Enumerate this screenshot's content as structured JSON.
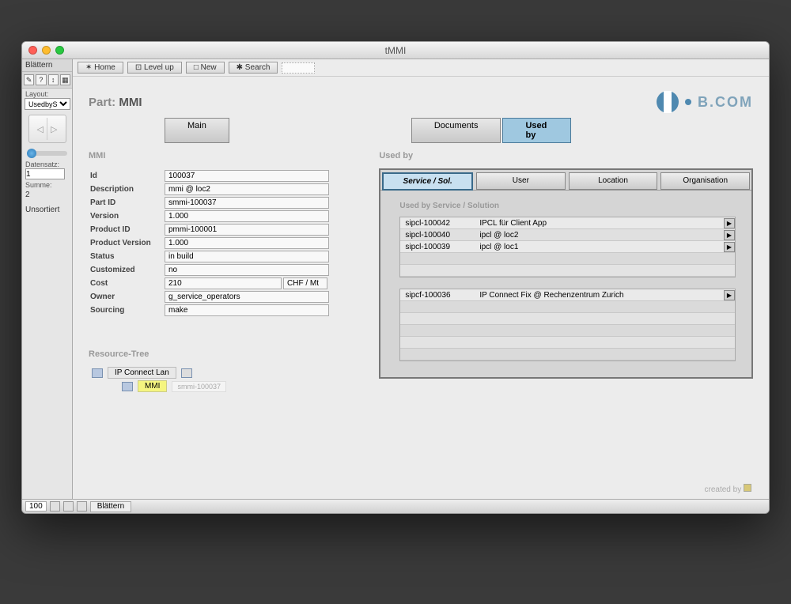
{
  "window": {
    "title": "tMMI"
  },
  "leftpane": {
    "blattern": "Blättern",
    "layout_lbl": "Layout:",
    "layout_val": "UsedbySe",
    "datensatz_lbl": "Datensatz:",
    "datensatz_val": "1",
    "summe_lbl": "Summe:",
    "summe_val": "2",
    "unsortiert": "Unsortiert"
  },
  "toolbar": {
    "home": "✶ Home",
    "levelup": "⊡ Level up",
    "new": "□ New",
    "search": "✱ Search"
  },
  "page": {
    "title_pre": "Part: ",
    "title": "MMI",
    "brand": "B.COM"
  },
  "tabs_main": {
    "main": "Main",
    "docs": "Documents",
    "usedby": "Used by"
  },
  "section_left": "MMI",
  "form": {
    "id_l": "Id",
    "id_v": "100037",
    "desc_l": "Description",
    "desc_v": "mmi @ loc2",
    "partid_l": "Part ID",
    "partid_v": "smmi-100037",
    "ver_l": "Version",
    "ver_v": "1.000",
    "prodid_l": "Product ID",
    "prodid_v": "pmmi-100001",
    "prodver_l": "Product Version",
    "prodver_v": "1.000",
    "status_l": "Status",
    "status_v": "in build",
    "cust_l": "Customized",
    "cust_v": "no",
    "cost_l": "Cost",
    "cost_v": "210",
    "cost_unit": "CHF / Mt",
    "owner_l": "Owner",
    "owner_v": "g_service_operators",
    "src_l": "Sourcing",
    "src_v": "make"
  },
  "section_right": "Used by",
  "tabs_used": {
    "svc": "Service / Sol.",
    "user": "User",
    "loc": "Location",
    "org": "Organisation"
  },
  "used_sub": "Used by Service / Solution",
  "used_rows": [
    {
      "id": "sipcl-100042",
      "desc": "IPCL für Client App"
    },
    {
      "id": "sipcl-100040",
      "desc": "ipcl @ loc2"
    },
    {
      "id": "sipcl-100039",
      "desc": "ipcl @ loc1"
    }
  ],
  "used_rows2": [
    {
      "id": "sipcf-100036",
      "desc": "IP Connect Fix @ Rechenzentrum Zurich"
    }
  ],
  "restree": {
    "title": "Resource-Tree",
    "node1": "IP Connect Lan",
    "node2": "MMI",
    "node2_id": "smmi-100037"
  },
  "footer": {
    "created": "created by"
  },
  "statusbar": {
    "val": "100",
    "tab": "Blättern"
  }
}
